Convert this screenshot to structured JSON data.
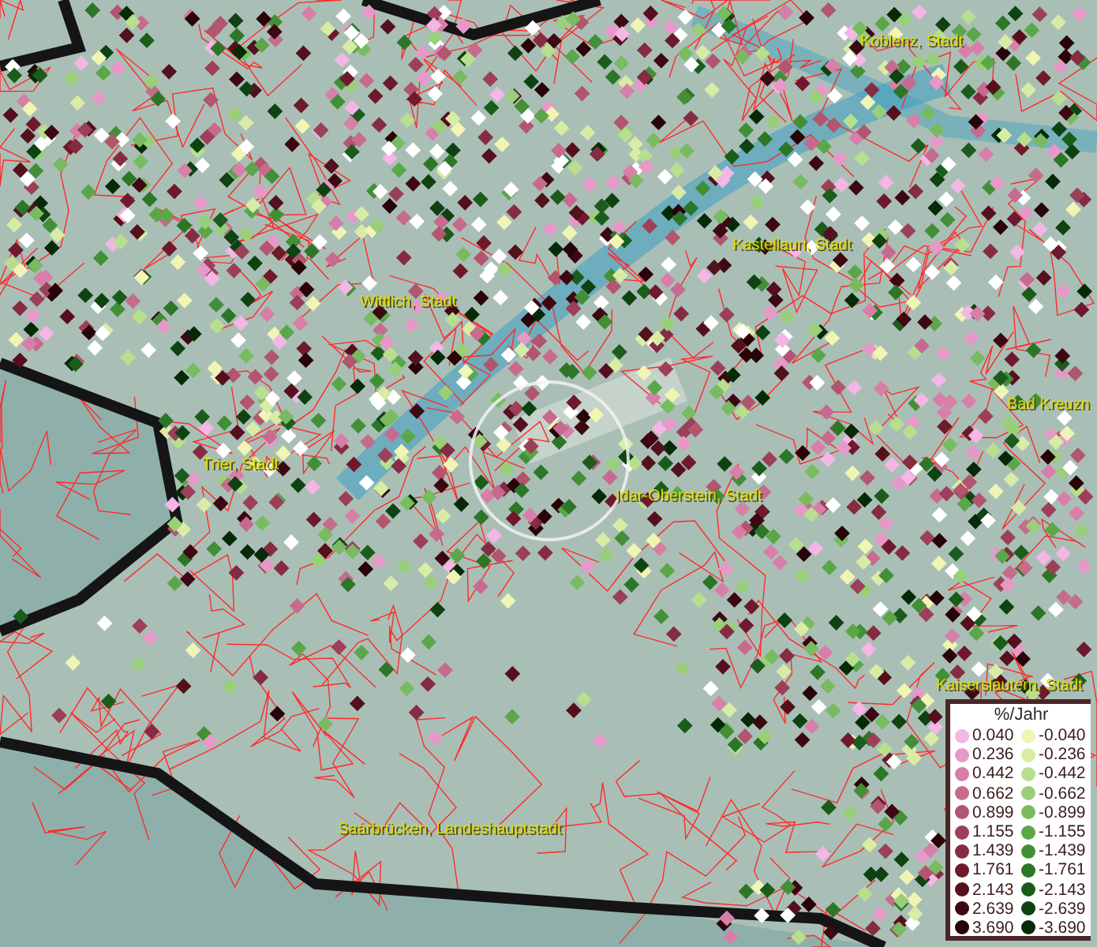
{
  "map": {
    "place_labels": [
      {
        "text": "Koblenz, Stadt"
      },
      {
        "text": "Kastellaun, Stadt"
      },
      {
        "text": "Wittlich, Stadt"
      },
      {
        "text": "Bad Kreuzn"
      },
      {
        "text": "Trier, Stadt"
      },
      {
        "text": "Idar-Oberstein, Stadt"
      },
      {
        "text": "Kaiserslautern, Stadt"
      },
      {
        "text": "Saarbrücken, Landeshauptstadt"
      }
    ]
  },
  "legend": {
    "title": "%/Jahr",
    "rows": [
      {
        "increase": {
          "label": "0.040",
          "color": "#f4b6e4"
        },
        "decrease": {
          "label": "-0.040",
          "color": "#f0f5b4"
        }
      },
      {
        "increase": {
          "label": "0.236",
          "color": "#e699c8"
        },
        "decrease": {
          "label": "-0.236",
          "color": "#d8eca6"
        }
      },
      {
        "increase": {
          "label": "0.442",
          "color": "#d77fa8"
        },
        "decrease": {
          "label": "-0.442",
          "color": "#b8df8e"
        }
      },
      {
        "increase": {
          "label": "0.662",
          "color": "#c76b8e"
        },
        "decrease": {
          "label": "-0.662",
          "color": "#98cf78"
        }
      },
      {
        "increase": {
          "label": "0.899",
          "color": "#b2556f"
        },
        "decrease": {
          "label": "-0.899",
          "color": "#78bb60"
        }
      },
      {
        "increase": {
          "label": "1.155",
          "color": "#9c3f58"
        },
        "decrease": {
          "label": "-1.155",
          "color": "#5ca64a"
        }
      },
      {
        "increase": {
          "label": "1.439",
          "color": "#852b42"
        },
        "decrease": {
          "label": "-1.439",
          "color": "#428f38"
        }
      },
      {
        "increase": {
          "label": "1.761",
          "color": "#6e1a2c"
        },
        "decrease": {
          "label": "-1.761",
          "color": "#2c7628"
        }
      },
      {
        "increase": {
          "label": "2.143",
          "color": "#55101d"
        },
        "decrease": {
          "label": "-2.143",
          "color": "#1b5c1c"
        }
      },
      {
        "increase": {
          "label": "2.639",
          "color": "#3e0812"
        },
        "decrease": {
          "label": "-2.639",
          "color": "#0f4212"
        }
      },
      {
        "increase": {
          "label": "3.690",
          "color": "#280308"
        },
        "decrease": {
          "label": "-3.690",
          "color": "#062a08"
        }
      }
    ]
  }
}
